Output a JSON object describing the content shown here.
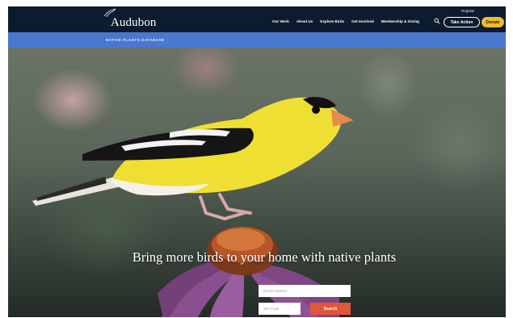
{
  "header": {
    "logo_text": "Audubon",
    "register_label": "Register",
    "nav_links": [
      "Our Work",
      "About Us",
      "Explore Birds",
      "Get Involved",
      "Membership & Giving"
    ],
    "take_action_label": "Take Action",
    "donate_label": "Donate"
  },
  "subbar": {
    "label": "NATIVE PLANTS DATABASE"
  },
  "hero": {
    "headline": "Bring more birds to your home with native plants",
    "email_placeholder": "Email Address",
    "zip_placeholder": "ZIP Code",
    "search_label": "Search"
  },
  "colors": {
    "nav_bg": "#0d1b2e",
    "subbar_bg": "#4a78d0",
    "donate_bg": "#f6b926",
    "search_button_bg": "#e2563a",
    "bird_yellow": "#f2e23a"
  },
  "icons": {
    "logo_mark": "bird-outline-icon",
    "search": "search-icon"
  }
}
